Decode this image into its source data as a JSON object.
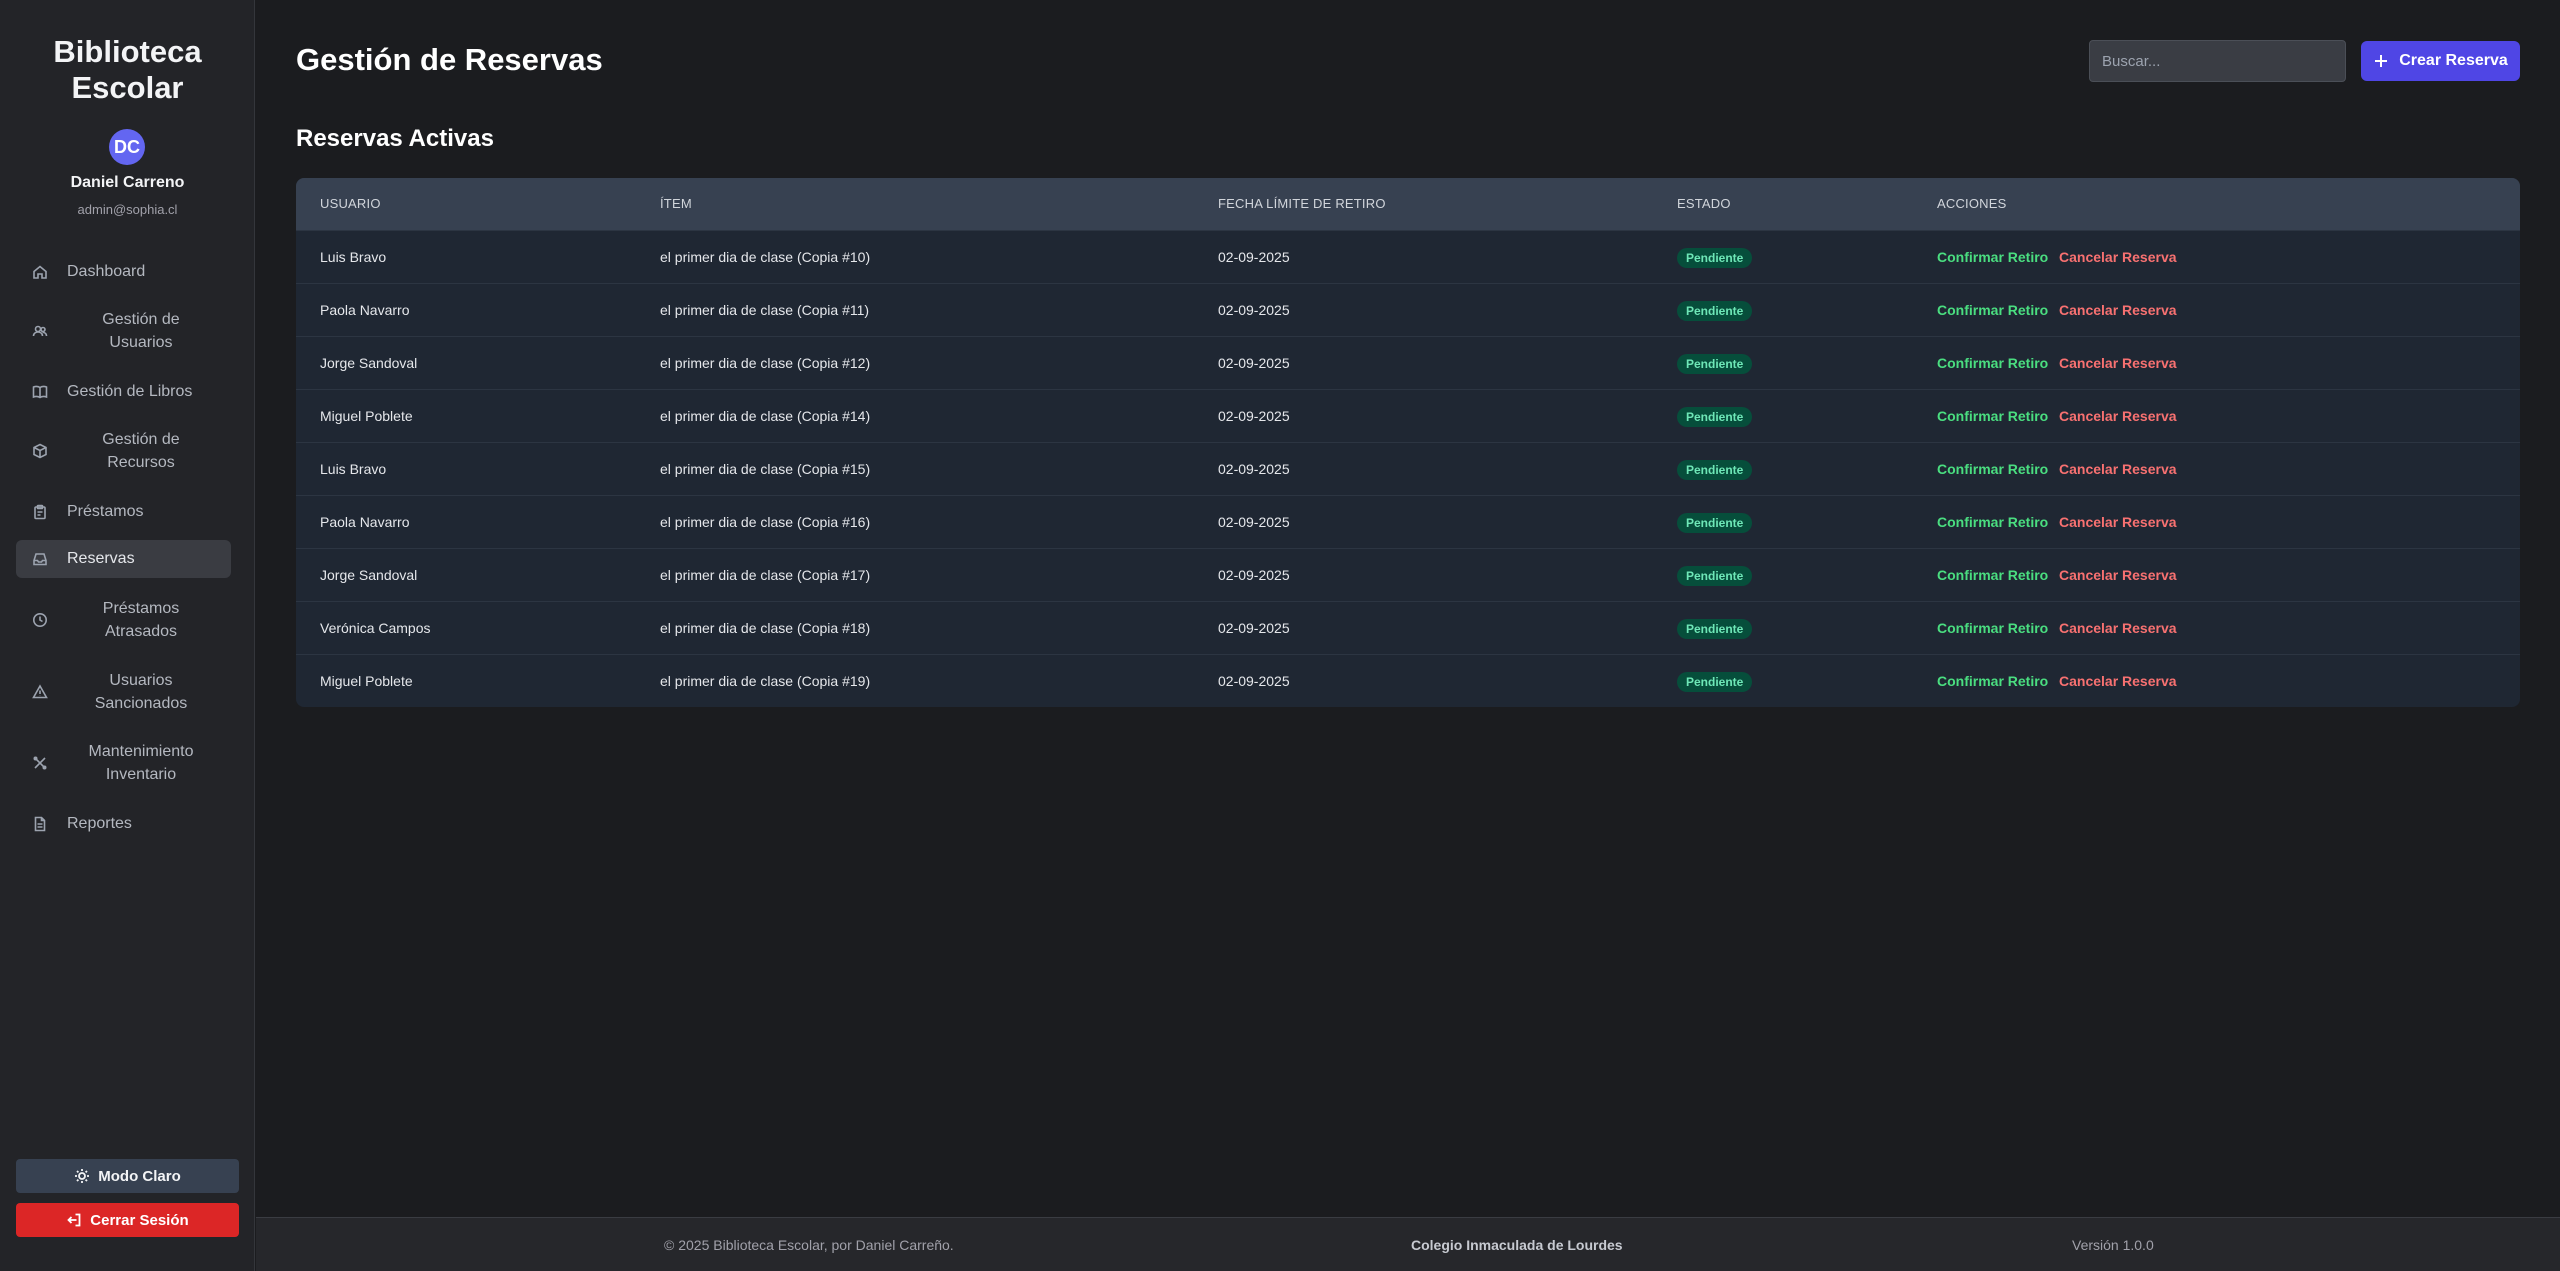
{
  "sidebar": {
    "brand_line1": "Biblioteca",
    "brand_line2": "Escolar",
    "avatar_initials": "DC",
    "user_name": "Daniel Carreno",
    "user_email": "admin@sophia.cl",
    "items": [
      {
        "label": "Dashboard",
        "icon": "home-icon"
      },
      {
        "label": "Gestión de Usuarios",
        "line1": "Gestión de",
        "line2": "Usuarios",
        "icon": "users-icon"
      },
      {
        "label": "Gestión de Libros",
        "icon": "book-icon"
      },
      {
        "label": "Gestión de Recursos",
        "line1": "Gestión de",
        "line2": "Recursos",
        "icon": "cube-icon"
      },
      {
        "label": "Préstamos",
        "icon": "clipboard-icon"
      },
      {
        "label": "Reservas",
        "icon": "inbox-icon",
        "active": true
      },
      {
        "label": "Préstamos Atrasados",
        "line1": "Préstamos",
        "line2": "Atrasados",
        "icon": "clock-icon"
      },
      {
        "label": "Usuarios Sancionados",
        "line1": "Usuarios",
        "line2": "Sancionados",
        "icon": "warning-icon"
      },
      {
        "label": "Mantenimiento Inventario",
        "line1": "Mantenimiento",
        "line2": "Inventario",
        "icon": "wrench-icon"
      },
      {
        "label": "Reportes",
        "icon": "document-icon"
      }
    ],
    "mode_label": "Modo Claro",
    "logout_label": "Cerrar Sesión"
  },
  "header": {
    "title": "Gestión de Reservas",
    "search_placeholder": "Buscar...",
    "create_label": "Crear Reserva"
  },
  "section": {
    "title": "Reservas Activas"
  },
  "table": {
    "columns": [
      "Usuario",
      "Ítem",
      "Fecha Límite de Retiro",
      "Estado",
      "Acciones"
    ],
    "rows": [
      {
        "usuario": "Luis Bravo",
        "item": "el primer dia de clase (Copia #10)",
        "fecha": "02-09-2025",
        "estado": "Pendiente"
      },
      {
        "usuario": "Paola Navarro",
        "item": "el primer dia de clase (Copia #11)",
        "fecha": "02-09-2025",
        "estado": "Pendiente"
      },
      {
        "usuario": "Jorge Sandoval",
        "item": "el primer dia de clase (Copia #12)",
        "fecha": "02-09-2025",
        "estado": "Pendiente"
      },
      {
        "usuario": "Miguel Poblete",
        "item": "el primer dia de clase (Copia #14)",
        "fecha": "02-09-2025",
        "estado": "Pendiente"
      },
      {
        "usuario": "Luis Bravo",
        "item": "el primer dia de clase (Copia #15)",
        "fecha": "02-09-2025",
        "estado": "Pendiente"
      },
      {
        "usuario": "Paola Navarro",
        "item": "el primer dia de clase (Copia #16)",
        "fecha": "02-09-2025",
        "estado": "Pendiente"
      },
      {
        "usuario": "Jorge Sandoval",
        "item": "el primer dia de clase (Copia #17)",
        "fecha": "02-09-2025",
        "estado": "Pendiente"
      },
      {
        "usuario": "Verónica Campos",
        "item": "el primer dia de clase (Copia #18)",
        "fecha": "02-09-2025",
        "estado": "Pendiente"
      },
      {
        "usuario": "Miguel Poblete",
        "item": "el primer dia de clase (Copia #19)",
        "fecha": "02-09-2025",
        "estado": "Pendiente"
      }
    ],
    "confirm_label": "Confirmar Retiro",
    "cancel_label": "Cancelar Reserva"
  },
  "footer": {
    "copyright": "© 2025 Biblioteca Escolar, por Daniel Carreño.",
    "school": "Colegio Inmaculada de Lourdes",
    "version": "Versión 1.0.0"
  },
  "colors": {
    "accent": "#4f46e5",
    "danger": "#dc2626",
    "confirm": "#4ade80",
    "cancel": "#f87171",
    "badge_bg": "#064e3b",
    "badge_text": "#6ee7b7"
  }
}
